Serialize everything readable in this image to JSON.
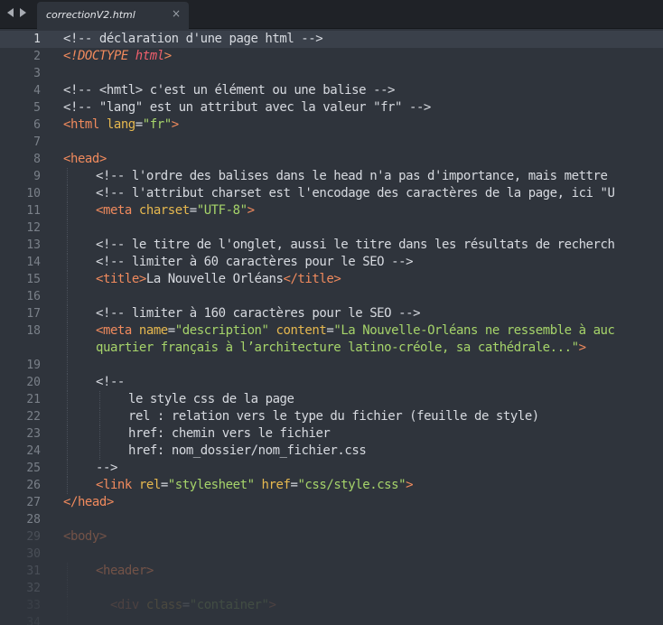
{
  "tab": {
    "filename": "correctionV2.html",
    "close_glyph": "×"
  },
  "editor": {
    "current_line": 1,
    "lines": [
      {
        "n": "1",
        "indent": 0,
        "segs": [
          [
            "comment",
            "<!-- déclaration d'une page html -->"
          ]
        ]
      },
      {
        "n": "2",
        "indent": 0,
        "segs": [
          [
            "doctype",
            "<!DOCTYPE "
          ],
          [
            "docname",
            "html"
          ],
          [
            "doctype",
            ">"
          ]
        ]
      },
      {
        "n": "3",
        "indent": 0,
        "segs": []
      },
      {
        "n": "4",
        "indent": 0,
        "segs": [
          [
            "comment",
            "<!-- <hmtl> c'est un élément ou une balise -->"
          ]
        ]
      },
      {
        "n": "5",
        "indent": 0,
        "segs": [
          [
            "comment",
            "<!-- \"lang\" est un attribut avec la valeur \"fr\" -->"
          ]
        ]
      },
      {
        "n": "6",
        "indent": 0,
        "segs": [
          [
            "tag",
            "<html "
          ],
          [
            "attr",
            "lang"
          ],
          [
            "text",
            "="
          ],
          [
            "str",
            "\"fr\""
          ],
          [
            "tag",
            ">"
          ]
        ]
      },
      {
        "n": "7",
        "indent": 0,
        "segs": []
      },
      {
        "n": "8",
        "indent": 0,
        "segs": [
          [
            "tag",
            "<head>"
          ]
        ]
      },
      {
        "n": "9",
        "indent": 1,
        "segs": [
          [
            "comment",
            "<!-- l'ordre des balises dans le head n'a pas d'importance, mais mettre"
          ]
        ]
      },
      {
        "n": "10",
        "indent": 1,
        "segs": [
          [
            "comment",
            "<!-- l'attribut charset est l'encodage des caractères de la page, ici \"U"
          ]
        ]
      },
      {
        "n": "11",
        "indent": 1,
        "segs": [
          [
            "tag",
            "<meta "
          ],
          [
            "attr",
            "charset"
          ],
          [
            "text",
            "="
          ],
          [
            "str",
            "\"UTF-8\""
          ],
          [
            "tag",
            ">"
          ]
        ]
      },
      {
        "n": "12",
        "indent": 1,
        "segs": []
      },
      {
        "n": "13",
        "indent": 1,
        "segs": [
          [
            "comment",
            "<!-- le titre de l'onglet, aussi le titre dans les résultats de recherch"
          ]
        ]
      },
      {
        "n": "14",
        "indent": 1,
        "segs": [
          [
            "comment",
            "<!-- limiter à 60 caractères pour le SEO -->"
          ]
        ]
      },
      {
        "n": "15",
        "indent": 1,
        "segs": [
          [
            "tag",
            "<title>"
          ],
          [
            "text",
            "La Nouvelle Orléans"
          ],
          [
            "tag",
            "</title>"
          ]
        ]
      },
      {
        "n": "16",
        "indent": 1,
        "segs": []
      },
      {
        "n": "17",
        "indent": 1,
        "segs": [
          [
            "comment",
            "<!-- limiter à 160 caractères pour le SEO -->"
          ]
        ]
      },
      {
        "n": "18",
        "indent": 1,
        "segs": [
          [
            "tag",
            "<meta "
          ],
          [
            "attr",
            "name"
          ],
          [
            "text",
            "="
          ],
          [
            "str",
            "\"description\""
          ],
          [
            "text",
            " "
          ],
          [
            "attr",
            "content"
          ],
          [
            "text",
            "="
          ],
          [
            "str",
            "\"La Nouvelle-Orléans ne ressemble à auc"
          ]
        ]
      },
      {
        "n": "",
        "indent": 1,
        "segs": [
          [
            "str",
            "quartier français à l’architecture latino-créole, sa cathédrale...\""
          ],
          [
            "tag",
            ">"
          ]
        ]
      },
      {
        "n": "19",
        "indent": 1,
        "segs": []
      },
      {
        "n": "20",
        "indent": 1,
        "segs": [
          [
            "comment",
            "<!--"
          ]
        ]
      },
      {
        "n": "21",
        "indent": 2,
        "segs": [
          [
            "comment",
            "le style css de la page"
          ]
        ]
      },
      {
        "n": "22",
        "indent": 2,
        "segs": [
          [
            "comment",
            "rel : relation vers le type du fichier (feuille de style)"
          ]
        ]
      },
      {
        "n": "23",
        "indent": 2,
        "segs": [
          [
            "comment",
            "href: chemin vers le fichier"
          ]
        ]
      },
      {
        "n": "24",
        "indent": 2,
        "segs": [
          [
            "comment",
            "href: nom_dossier/nom_fichier.css"
          ]
        ]
      },
      {
        "n": "25",
        "indent": 1,
        "segs": [
          [
            "comment",
            "-->"
          ]
        ]
      },
      {
        "n": "26",
        "indent": 1,
        "segs": [
          [
            "tag",
            "<link "
          ],
          [
            "attr",
            "rel"
          ],
          [
            "text",
            "="
          ],
          [
            "str",
            "\"stylesheet\""
          ],
          [
            "text",
            " "
          ],
          [
            "attr",
            "href"
          ],
          [
            "text",
            "="
          ],
          [
            "str",
            "\"css/style.css\""
          ],
          [
            "tag",
            ">"
          ]
        ]
      },
      {
        "n": "27",
        "indent": 0,
        "segs": [
          [
            "tag",
            "</head>"
          ]
        ]
      },
      {
        "n": "28",
        "indent": 0,
        "segs": []
      },
      {
        "n": "29",
        "indent": 0,
        "fade": 1,
        "segs": [
          [
            "tag",
            "<body>"
          ]
        ]
      },
      {
        "n": "30",
        "indent": 0,
        "fade": 1,
        "segs": []
      },
      {
        "n": "31",
        "indent": 1,
        "fade": 1,
        "segs": [
          [
            "tag",
            "<header>"
          ]
        ]
      },
      {
        "n": "32",
        "indent": 1,
        "fade": 1,
        "segs": []
      },
      {
        "n": "33",
        "indent": 1,
        "fade": 2,
        "segs": [
          [
            "tag",
            "  <div "
          ],
          [
            "attr",
            "class"
          ],
          [
            "text",
            "="
          ],
          [
            "str",
            "\"container\""
          ],
          [
            "tag",
            ">"
          ]
        ]
      },
      {
        "n": "34",
        "indent": 1,
        "fade": 2,
        "segs": []
      }
    ]
  }
}
